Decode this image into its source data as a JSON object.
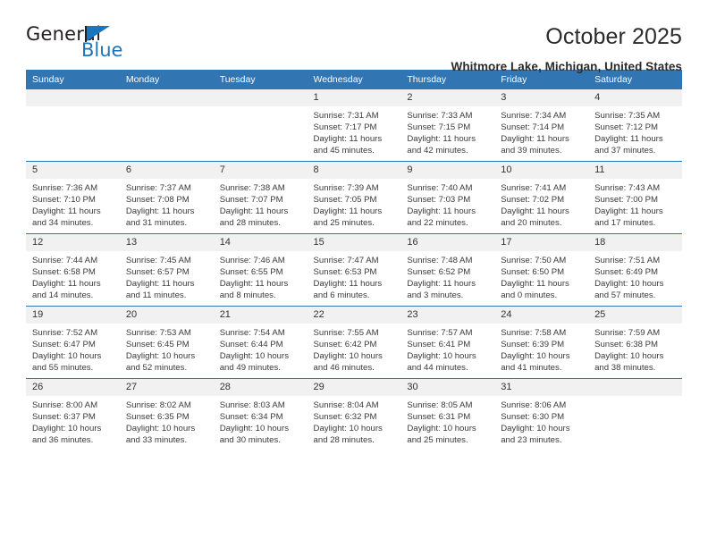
{
  "logo": {
    "word_one": "General",
    "word_two": "Blue",
    "flag_icon": "blue-triangle-flag"
  },
  "header": {
    "month_title": "October 2025",
    "location": "Whitmore Lake, Michigan, United States"
  },
  "colors": {
    "header_blue": "#3175b3",
    "logo_blue": "#1b75bc",
    "daynum_band": "#f1f1f1",
    "text": "#3a3a3a"
  },
  "calendar": {
    "weekday_headers": [
      "Sunday",
      "Monday",
      "Tuesday",
      "Wednesday",
      "Thursday",
      "Friday",
      "Saturday"
    ],
    "weeks": [
      [
        {
          "day": "",
          "empty": true,
          "sunrise": "",
          "sunset": "",
          "daylight_a": "",
          "daylight_b": ""
        },
        {
          "day": "",
          "empty": true,
          "sunrise": "",
          "sunset": "",
          "daylight_a": "",
          "daylight_b": ""
        },
        {
          "day": "",
          "empty": true,
          "sunrise": "",
          "sunset": "",
          "daylight_a": "",
          "daylight_b": ""
        },
        {
          "day": "1",
          "empty": false,
          "sunrise": "Sunrise: 7:31 AM",
          "sunset": "Sunset: 7:17 PM",
          "daylight_a": "Daylight: 11 hours",
          "daylight_b": "and 45 minutes."
        },
        {
          "day": "2",
          "empty": false,
          "sunrise": "Sunrise: 7:33 AM",
          "sunset": "Sunset: 7:15 PM",
          "daylight_a": "Daylight: 11 hours",
          "daylight_b": "and 42 minutes."
        },
        {
          "day": "3",
          "empty": false,
          "sunrise": "Sunrise: 7:34 AM",
          "sunset": "Sunset: 7:14 PM",
          "daylight_a": "Daylight: 11 hours",
          "daylight_b": "and 39 minutes."
        },
        {
          "day": "4",
          "empty": false,
          "sunrise": "Sunrise: 7:35 AM",
          "sunset": "Sunset: 7:12 PM",
          "daylight_a": "Daylight: 11 hours",
          "daylight_b": "and 37 minutes."
        }
      ],
      [
        {
          "day": "5",
          "empty": false,
          "sunrise": "Sunrise: 7:36 AM",
          "sunset": "Sunset: 7:10 PM",
          "daylight_a": "Daylight: 11 hours",
          "daylight_b": "and 34 minutes."
        },
        {
          "day": "6",
          "empty": false,
          "sunrise": "Sunrise: 7:37 AM",
          "sunset": "Sunset: 7:08 PM",
          "daylight_a": "Daylight: 11 hours",
          "daylight_b": "and 31 minutes."
        },
        {
          "day": "7",
          "empty": false,
          "sunrise": "Sunrise: 7:38 AM",
          "sunset": "Sunset: 7:07 PM",
          "daylight_a": "Daylight: 11 hours",
          "daylight_b": "and 28 minutes."
        },
        {
          "day": "8",
          "empty": false,
          "sunrise": "Sunrise: 7:39 AM",
          "sunset": "Sunset: 7:05 PM",
          "daylight_a": "Daylight: 11 hours",
          "daylight_b": "and 25 minutes."
        },
        {
          "day": "9",
          "empty": false,
          "sunrise": "Sunrise: 7:40 AM",
          "sunset": "Sunset: 7:03 PM",
          "daylight_a": "Daylight: 11 hours",
          "daylight_b": "and 22 minutes."
        },
        {
          "day": "10",
          "empty": false,
          "sunrise": "Sunrise: 7:41 AM",
          "sunset": "Sunset: 7:02 PM",
          "daylight_a": "Daylight: 11 hours",
          "daylight_b": "and 20 minutes."
        },
        {
          "day": "11",
          "empty": false,
          "sunrise": "Sunrise: 7:43 AM",
          "sunset": "Sunset: 7:00 PM",
          "daylight_a": "Daylight: 11 hours",
          "daylight_b": "and 17 minutes."
        }
      ],
      [
        {
          "day": "12",
          "empty": false,
          "sunrise": "Sunrise: 7:44 AM",
          "sunset": "Sunset: 6:58 PM",
          "daylight_a": "Daylight: 11 hours",
          "daylight_b": "and 14 minutes."
        },
        {
          "day": "13",
          "empty": false,
          "sunrise": "Sunrise: 7:45 AM",
          "sunset": "Sunset: 6:57 PM",
          "daylight_a": "Daylight: 11 hours",
          "daylight_b": "and 11 minutes."
        },
        {
          "day": "14",
          "empty": false,
          "sunrise": "Sunrise: 7:46 AM",
          "sunset": "Sunset: 6:55 PM",
          "daylight_a": "Daylight: 11 hours",
          "daylight_b": "and 8 minutes."
        },
        {
          "day": "15",
          "empty": false,
          "sunrise": "Sunrise: 7:47 AM",
          "sunset": "Sunset: 6:53 PM",
          "daylight_a": "Daylight: 11 hours",
          "daylight_b": "and 6 minutes."
        },
        {
          "day": "16",
          "empty": false,
          "sunrise": "Sunrise: 7:48 AM",
          "sunset": "Sunset: 6:52 PM",
          "daylight_a": "Daylight: 11 hours",
          "daylight_b": "and 3 minutes."
        },
        {
          "day": "17",
          "empty": false,
          "sunrise": "Sunrise: 7:50 AM",
          "sunset": "Sunset: 6:50 PM",
          "daylight_a": "Daylight: 11 hours",
          "daylight_b": "and 0 minutes."
        },
        {
          "day": "18",
          "empty": false,
          "sunrise": "Sunrise: 7:51 AM",
          "sunset": "Sunset: 6:49 PM",
          "daylight_a": "Daylight: 10 hours",
          "daylight_b": "and 57 minutes."
        }
      ],
      [
        {
          "day": "19",
          "empty": false,
          "sunrise": "Sunrise: 7:52 AM",
          "sunset": "Sunset: 6:47 PM",
          "daylight_a": "Daylight: 10 hours",
          "daylight_b": "and 55 minutes."
        },
        {
          "day": "20",
          "empty": false,
          "sunrise": "Sunrise: 7:53 AM",
          "sunset": "Sunset: 6:45 PM",
          "daylight_a": "Daylight: 10 hours",
          "daylight_b": "and 52 minutes."
        },
        {
          "day": "21",
          "empty": false,
          "sunrise": "Sunrise: 7:54 AM",
          "sunset": "Sunset: 6:44 PM",
          "daylight_a": "Daylight: 10 hours",
          "daylight_b": "and 49 minutes."
        },
        {
          "day": "22",
          "empty": false,
          "sunrise": "Sunrise: 7:55 AM",
          "sunset": "Sunset: 6:42 PM",
          "daylight_a": "Daylight: 10 hours",
          "daylight_b": "and 46 minutes."
        },
        {
          "day": "23",
          "empty": false,
          "sunrise": "Sunrise: 7:57 AM",
          "sunset": "Sunset: 6:41 PM",
          "daylight_a": "Daylight: 10 hours",
          "daylight_b": "and 44 minutes."
        },
        {
          "day": "24",
          "empty": false,
          "sunrise": "Sunrise: 7:58 AM",
          "sunset": "Sunset: 6:39 PM",
          "daylight_a": "Daylight: 10 hours",
          "daylight_b": "and 41 minutes."
        },
        {
          "day": "25",
          "empty": false,
          "sunrise": "Sunrise: 7:59 AM",
          "sunset": "Sunset: 6:38 PM",
          "daylight_a": "Daylight: 10 hours",
          "daylight_b": "and 38 minutes."
        }
      ],
      [
        {
          "day": "26",
          "empty": false,
          "sunrise": "Sunrise: 8:00 AM",
          "sunset": "Sunset: 6:37 PM",
          "daylight_a": "Daylight: 10 hours",
          "daylight_b": "and 36 minutes."
        },
        {
          "day": "27",
          "empty": false,
          "sunrise": "Sunrise: 8:02 AM",
          "sunset": "Sunset: 6:35 PM",
          "daylight_a": "Daylight: 10 hours",
          "daylight_b": "and 33 minutes."
        },
        {
          "day": "28",
          "empty": false,
          "sunrise": "Sunrise: 8:03 AM",
          "sunset": "Sunset: 6:34 PM",
          "daylight_a": "Daylight: 10 hours",
          "daylight_b": "and 30 minutes."
        },
        {
          "day": "29",
          "empty": false,
          "sunrise": "Sunrise: 8:04 AM",
          "sunset": "Sunset: 6:32 PM",
          "daylight_a": "Daylight: 10 hours",
          "daylight_b": "and 28 minutes."
        },
        {
          "day": "30",
          "empty": false,
          "sunrise": "Sunrise: 8:05 AM",
          "sunset": "Sunset: 6:31 PM",
          "daylight_a": "Daylight: 10 hours",
          "daylight_b": "and 25 minutes."
        },
        {
          "day": "31",
          "empty": false,
          "sunrise": "Sunrise: 8:06 AM",
          "sunset": "Sunset: 6:30 PM",
          "daylight_a": "Daylight: 10 hours",
          "daylight_b": "and 23 minutes."
        },
        {
          "day": "",
          "empty": true,
          "sunrise": "",
          "sunset": "",
          "daylight_a": "",
          "daylight_b": ""
        }
      ]
    ]
  }
}
